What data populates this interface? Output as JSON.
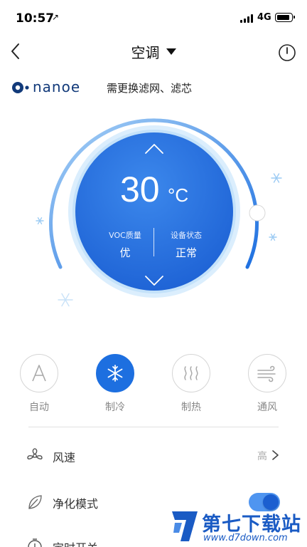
{
  "status_bar": {
    "time": "10:57",
    "location_arrow": "↗",
    "network": "4G"
  },
  "header": {
    "title": "空调",
    "back_icon": "chevron-left-icon",
    "power_icon": "power-icon",
    "dropdown_icon": "caret-down-icon"
  },
  "nanoe": {
    "logo_text": "nanoe",
    "message": "需更换滤网、滤芯"
  },
  "dial": {
    "temperature": "30",
    "unit": "°C",
    "voc_label": "VOC质量",
    "voc_value": "优",
    "device_label": "设备状态",
    "device_value": "正常",
    "accent_color": "#1d6fe0"
  },
  "modes": [
    {
      "label": "自动",
      "icon": "auto-a-icon",
      "active": false
    },
    {
      "label": "制冷",
      "icon": "snowflake-icon",
      "active": true
    },
    {
      "label": "制热",
      "icon": "heat-waves-icon",
      "active": false
    },
    {
      "label": "通风",
      "icon": "wind-icon",
      "active": false
    }
  ],
  "settings": {
    "fan_speed": {
      "label": "风速",
      "value": "高",
      "icon": "fan-icon"
    },
    "purify_mode": {
      "label": "净化模式",
      "icon": "leaf-icon",
      "enabled": true
    },
    "timer": {
      "label": "定时开关",
      "icon": "timer-icon"
    }
  },
  "watermark": {
    "title": "第七下载站",
    "url": "www.d7down.com"
  }
}
